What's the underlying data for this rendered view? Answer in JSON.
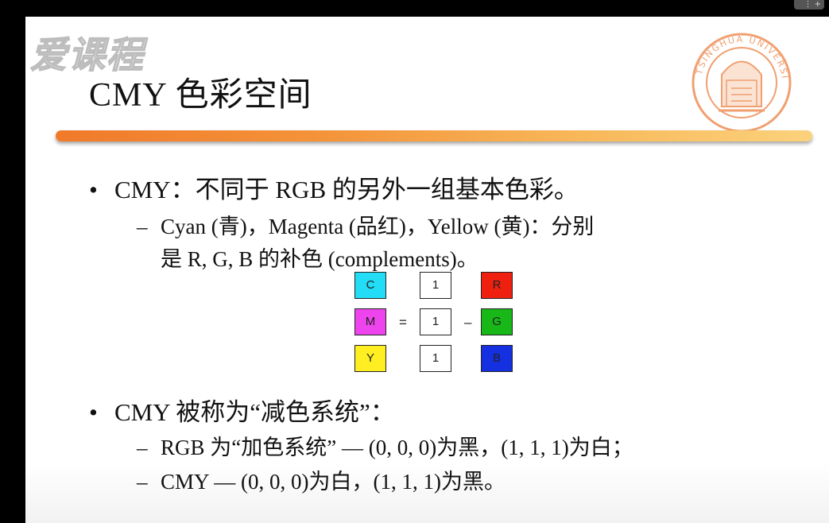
{
  "top_icons": "⋮ +",
  "watermark": "爱课程",
  "title": "CMY 色彩空间",
  "logo_text": "TSINGHUA UNIVERSITY",
  "bullets": [
    {
      "text": "CMY：不同于 RGB 的另外一组基本色彩。",
      "subs": [
        "Cyan (青)，Magenta (品红)，Yellow (黄)：分别",
        "是 R, G, B 的补色 (complements)。"
      ]
    },
    {
      "text": "CMY 被称为“减色系统”：",
      "subs": [
        "RGB 为“加色系统” — (0, 0, 0)为黑，(1, 1, 1)为白；",
        "CMY — (0, 0, 0)为白，(1, 1, 1)为黑。"
      ]
    }
  ],
  "bullet_symbol": "•",
  "dash_symbol": "–",
  "matrix": {
    "left": [
      {
        "label": "C",
        "color": "#22ddf5"
      },
      {
        "label": "M",
        "color": "#ee44ee"
      },
      {
        "label": "Y",
        "color": "#ffee22"
      }
    ],
    "ones": [
      "1",
      "1",
      "1"
    ],
    "right": [
      {
        "label": "R",
        "color": "#f02010"
      },
      {
        "label": "G",
        "color": "#18b818"
      },
      {
        "label": "B",
        "color": "#1430e0"
      }
    ],
    "equals": "=",
    "minus": "–"
  },
  "colors": {
    "divider_start": "#f07a2a",
    "divider_end": "#fbd27c",
    "logo": "#f0a070"
  }
}
